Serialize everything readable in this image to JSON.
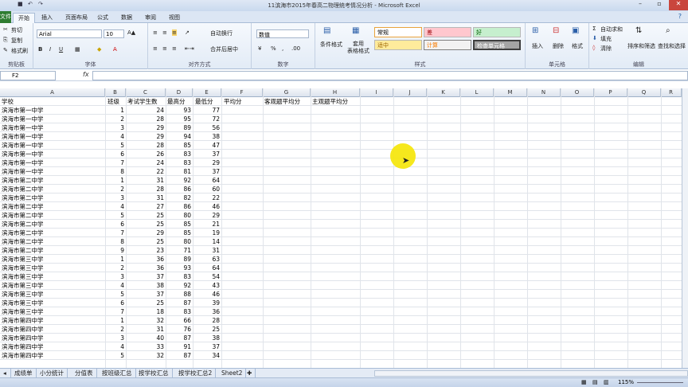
{
  "window": {
    "title": "11滨海市2015年春高二物理统考情况分析 - Microsoft Excel"
  },
  "ribbon_tabs": [
    "开始",
    "插入",
    "页面布局",
    "公式",
    "数据",
    "审阅",
    "视图"
  ],
  "file_tab": "文件",
  "clipboard": {
    "cut": "剪切",
    "copy": "复制",
    "format_painter": "格式刷",
    "label": "剪贴板"
  },
  "font": {
    "name": "Arial",
    "size": "10",
    "label": "字体"
  },
  "alignment": {
    "wrap": "自动换行",
    "merge": "合并后居中",
    "label": "对齐方式"
  },
  "number": {
    "format": "数值",
    "label": "数字"
  },
  "styles": {
    "conditional": "条件格式",
    "table_format": "套用\n表格格式",
    "normal": "常规",
    "bad": "差",
    "good": "好",
    "neutral": "适中",
    "calc": "计算",
    "check": "检查单元格",
    "label": "样式"
  },
  "cells": {
    "insert": "插入",
    "delete": "删除",
    "format": "格式",
    "label": "单元格"
  },
  "editing": {
    "autosum": "自动求和",
    "fill": "填充",
    "clear": "清除",
    "sort": "排序和筛选",
    "find": "查找和选择",
    "label": "编辑"
  },
  "namebox": "F2",
  "columns": [
    "A",
    "B",
    "C",
    "D",
    "E",
    "F",
    "G",
    "H",
    "I",
    "J",
    "K",
    "L",
    "M",
    "N",
    "O",
    "P",
    "Q",
    "R"
  ],
  "headers": [
    "学校",
    "班级",
    "考试学生数",
    "最高分",
    "最低分",
    "平均分",
    "客观题平均分",
    "主观题平均分"
  ],
  "rows": [
    [
      "滨海市第一中学",
      "1",
      "24",
      "93",
      "77"
    ],
    [
      "滨海市第一中学",
      "2",
      "28",
      "95",
      "72"
    ],
    [
      "滨海市第一中学",
      "3",
      "29",
      "89",
      "56"
    ],
    [
      "滨海市第一中学",
      "4",
      "29",
      "94",
      "38"
    ],
    [
      "滨海市第一中学",
      "5",
      "28",
      "85",
      "47"
    ],
    [
      "滨海市第一中学",
      "6",
      "26",
      "83",
      "37"
    ],
    [
      "滨海市第一中学",
      "7",
      "24",
      "83",
      "29"
    ],
    [
      "滨海市第一中学",
      "8",
      "22",
      "81",
      "37"
    ],
    [
      "滨海市第二中学",
      "1",
      "31",
      "92",
      "64"
    ],
    [
      "滨海市第二中学",
      "2",
      "28",
      "86",
      "60"
    ],
    [
      "滨海市第二中学",
      "3",
      "31",
      "82",
      "22"
    ],
    [
      "滨海市第二中学",
      "4",
      "27",
      "86",
      "46"
    ],
    [
      "滨海市第二中学",
      "5",
      "25",
      "80",
      "29"
    ],
    [
      "滨海市第二中学",
      "6",
      "25",
      "85",
      "21"
    ],
    [
      "滨海市第二中学",
      "7",
      "29",
      "85",
      "19"
    ],
    [
      "滨海市第二中学",
      "8",
      "25",
      "80",
      "14"
    ],
    [
      "滨海市第二中学",
      "9",
      "23",
      "71",
      "31"
    ],
    [
      "滨海市第三中学",
      "1",
      "36",
      "89",
      "63"
    ],
    [
      "滨海市第三中学",
      "2",
      "36",
      "93",
      "64"
    ],
    [
      "滨海市第三中学",
      "3",
      "37",
      "83",
      "54"
    ],
    [
      "滨海市第三中学",
      "4",
      "38",
      "92",
      "43"
    ],
    [
      "滨海市第三中学",
      "5",
      "37",
      "88",
      "46"
    ],
    [
      "滨海市第三中学",
      "6",
      "25",
      "87",
      "39"
    ],
    [
      "滨海市第三中学",
      "7",
      "18",
      "83",
      "36"
    ],
    [
      "滨海市第四中学",
      "1",
      "32",
      "66",
      "28"
    ],
    [
      "滨海市第四中学",
      "2",
      "31",
      "76",
      "25"
    ],
    [
      "滨海市第四中学",
      "3",
      "40",
      "87",
      "38"
    ],
    [
      "滨海市第四中学",
      "4",
      "33",
      "91",
      "37"
    ],
    [
      "滨海市第四中学",
      "5",
      "32",
      "87",
      "34"
    ]
  ],
  "sheet_tabs": [
    "成绩单",
    "小分统计",
    "分值表",
    "按班级汇总",
    "按学校汇总",
    "按学校汇总2",
    "Sheet2"
  ],
  "status": {
    "zoom": "115%"
  },
  "colors": {
    "accent": "#2f7d32",
    "highlight": "#f5e60a"
  }
}
